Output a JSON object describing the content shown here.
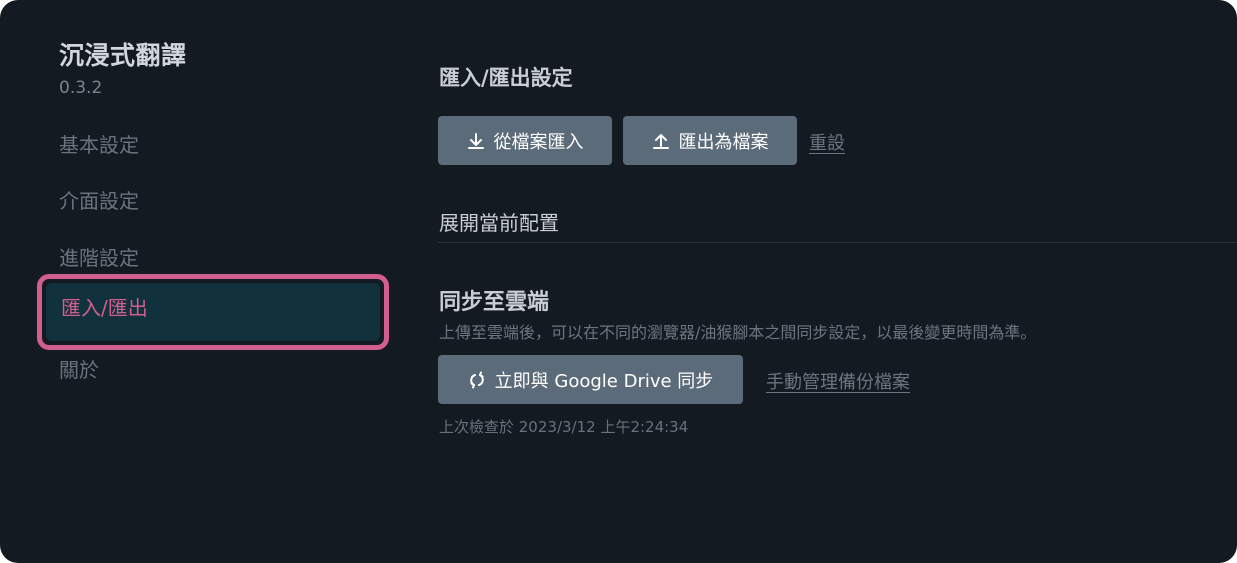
{
  "sidebar": {
    "title": "沉浸式翻譯",
    "version": "0.3.2",
    "items": [
      {
        "label": "基本設定",
        "active": false
      },
      {
        "label": "介面設定",
        "active": false
      },
      {
        "label": "進階設定",
        "active": false
      },
      {
        "label": "匯入/匯出",
        "active": true
      },
      {
        "label": "關於",
        "active": false
      }
    ]
  },
  "main": {
    "section_title": "匯入/匯出設定",
    "import_button": {
      "label": "從檔案匯入",
      "icon": "download-icon"
    },
    "export_button": {
      "label": "匯出為檔案",
      "icon": "upload-icon"
    },
    "reset_link": "重設",
    "expand_label": "展開當前配置",
    "sync": {
      "title": "同步至雲端",
      "description": "上傳至雲端後，可以在不同的瀏覽器/油猴腳本之間同步設定，以最後變更時間為準。",
      "sync_button": {
        "label": "立即與 Google Drive 同步",
        "icon": "sync-icon"
      },
      "manage_link": "手動管理備份檔案",
      "last_checked": "上次檢查於 2023/3/12 上午2:24:34"
    }
  },
  "colors": {
    "background": "#141a21",
    "button": "#5b6b79",
    "active_highlight": "#d15e8c",
    "active_bg": "#11323d"
  }
}
